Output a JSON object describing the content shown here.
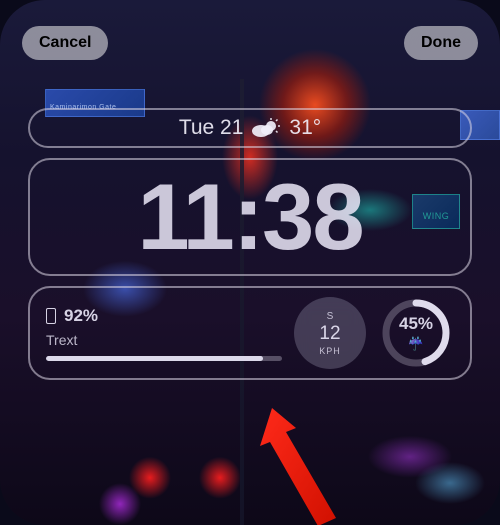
{
  "buttons": {
    "cancel": "Cancel",
    "done": "Done"
  },
  "date_row": {
    "day_date": "Tue 21",
    "temperature": "31°"
  },
  "clock": {
    "time": "11:38"
  },
  "widgets": {
    "battery": {
      "percent_text": "92%",
      "percent_value": 92,
      "label": "Trext"
    },
    "wind": {
      "direction": "S",
      "speed": "12",
      "unit": "KPH"
    },
    "precipitation": {
      "value": "45%",
      "progress": 45
    }
  },
  "background_signs": {
    "sign1": "Kaminarimon Gate",
    "sign3": "WING"
  }
}
